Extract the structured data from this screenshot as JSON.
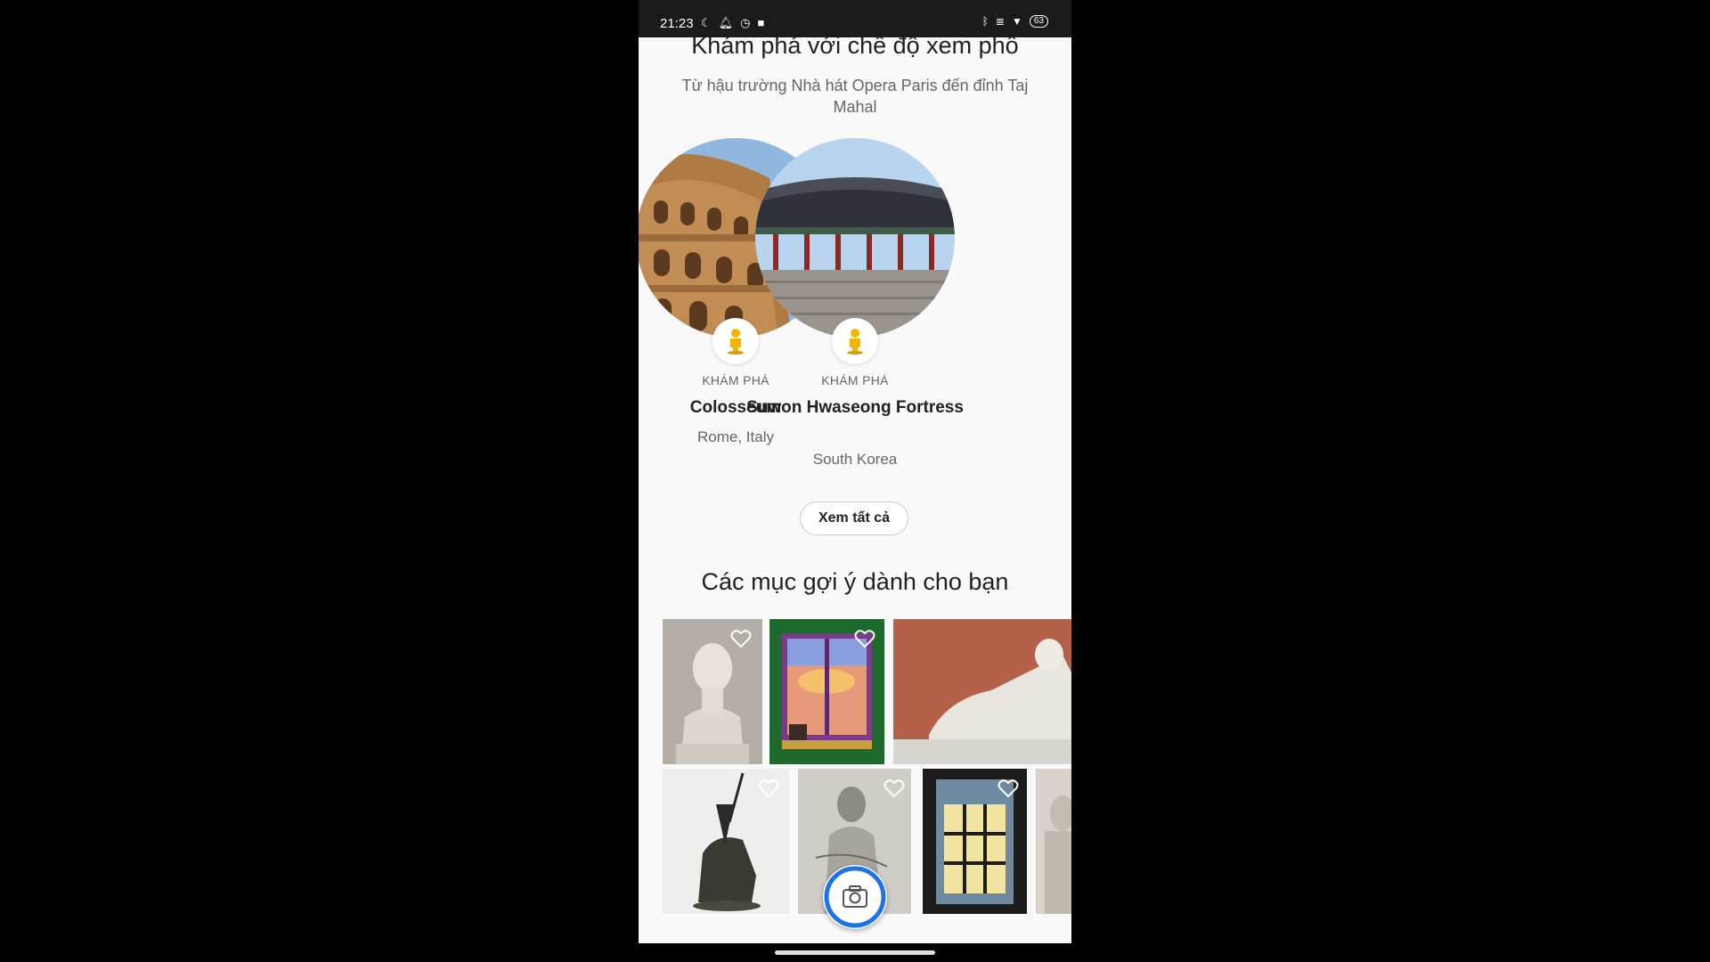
{
  "status_bar": {
    "time": "21:23",
    "battery": "63",
    "left_icons": [
      "moon-icon",
      "bell-icon",
      "alarm-icon",
      "video-icon"
    ],
    "right_icons": [
      "bluetooth-icon",
      "signal-icon",
      "wifi-icon",
      "battery-icon"
    ]
  },
  "street_view": {
    "title": "Khám phá với chế độ xem phố",
    "subtitle": "Từ hậu trường Nhà hát Opera Paris đến đỉnh Taj Mahal",
    "cards": [
      {
        "kicker": "KHÁM PHÁ",
        "title": "Colosseum",
        "subtitle": "Rome, Italy"
      },
      {
        "kicker": "KHÁM PHÁ",
        "title": "Suwon Hwaseong Fortress",
        "subtitle": "South Korea"
      }
    ],
    "see_all_label": "Xem tất cả"
  },
  "recommendations": {
    "title": "Các mục gợi ý dành cho bạn"
  },
  "colors": {
    "background": "#f8f9f8",
    "text_primary": "#202124",
    "text_secondary": "#666666",
    "badge_yellow": "#f4b400",
    "fab_ring": "#1a73e8"
  }
}
